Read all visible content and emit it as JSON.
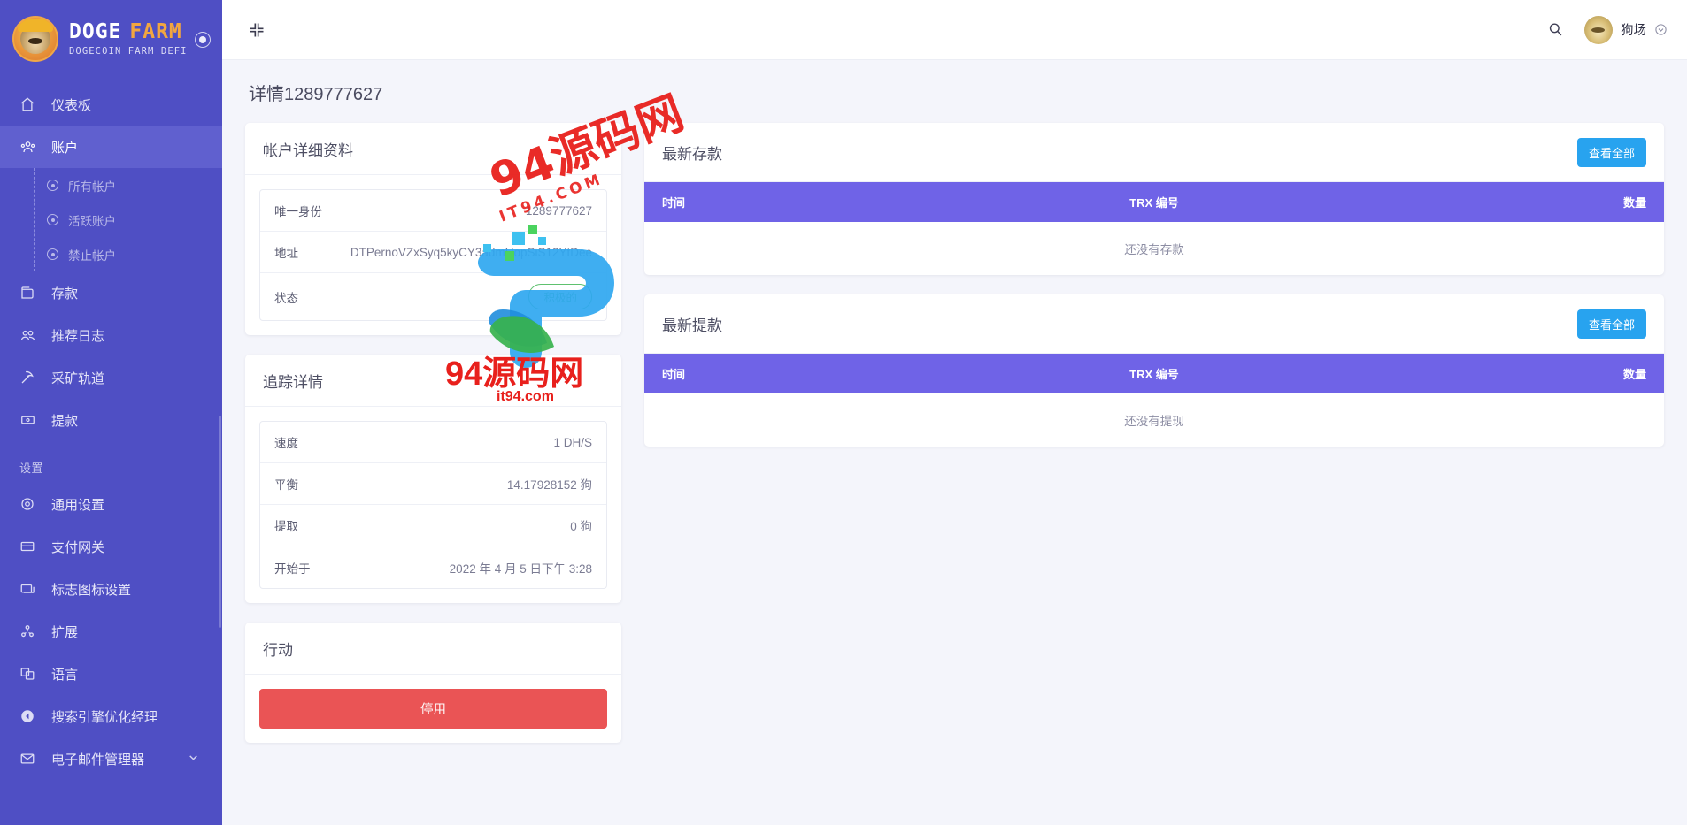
{
  "brand": {
    "title_part1": "DOGE",
    "title_part2": "FARM",
    "subtitle": "DOGECOIN FARM DEFI",
    "toggle_icon": "circle-dot-icon"
  },
  "sidebar": {
    "items": [
      {
        "label": "仪表板",
        "icon": "home-icon",
        "active": false
      },
      {
        "label": "账户",
        "icon": "users-icon",
        "active": true
      }
    ],
    "sub_items": [
      {
        "label": "所有帐户",
        "icon": "circle-dot-icon"
      },
      {
        "label": "活跃账户",
        "icon": "circle-dot-icon"
      },
      {
        "label": "禁止帐户",
        "icon": "circle-dot-icon"
      }
    ],
    "items2": [
      {
        "label": "存款",
        "icon": "wallet-icon"
      },
      {
        "label": "推荐日志",
        "icon": "people-icon"
      },
      {
        "label": "采矿轨道",
        "icon": "pickaxe-icon"
      },
      {
        "label": "提款",
        "icon": "money-icon"
      }
    ],
    "section_label": "设置",
    "items3": [
      {
        "label": "通用设置",
        "icon": "gear-icon",
        "caret": false
      },
      {
        "label": "支付网关",
        "icon": "card-icon",
        "caret": false
      },
      {
        "label": "标志图标设置",
        "icon": "image-icon",
        "caret": false
      },
      {
        "label": "扩展",
        "icon": "extension-icon",
        "caret": false
      },
      {
        "label": "语言",
        "icon": "language-icon",
        "caret": false
      },
      {
        "label": "搜索引擎优化经理",
        "icon": "seo-icon",
        "caret": false
      },
      {
        "label": "电子邮件管理器",
        "icon": "mail-icon",
        "caret": true
      }
    ]
  },
  "topbar": {
    "collapse_icon": "collapse-arrows-icon",
    "search_icon": "search-icon",
    "user_name": "狗场",
    "user_caret_icon": "chevron-down-icon",
    "avatar_icon": "doge-avatar"
  },
  "page": {
    "title": "详情1289777627"
  },
  "account_details": {
    "title": "帐户详细资料",
    "rows": [
      {
        "key": "唯一身份",
        "value": "1289777627"
      },
      {
        "key": "地址",
        "value": "DTPernoVZxSyq5kyCY3admUopSiS12YtDee"
      },
      {
        "key": "状态",
        "value": "积极的",
        "type": "badge"
      }
    ]
  },
  "tracking_details": {
    "title": "追踪详情",
    "rows": [
      {
        "key": "速度",
        "value": "1 DH/S"
      },
      {
        "key": "平衡",
        "value": "14.17928152 狗"
      },
      {
        "key": "提取",
        "value": "0 狗"
      },
      {
        "key": "开始于",
        "value": "2022 年 4 月 5 日下午 3:28"
      }
    ]
  },
  "actions": {
    "title": "行动",
    "disable_label": "停用"
  },
  "latest_deposits": {
    "title": "最新存款",
    "view_all_label": "查看全部",
    "columns": [
      "时间",
      "TRX 编号",
      "数量"
    ],
    "empty_text": "还没有存款"
  },
  "latest_withdrawals": {
    "title": "最新提款",
    "view_all_label": "查看全部",
    "columns": [
      "时间",
      "TRX 编号",
      "数量"
    ],
    "empty_text": "还没有提现"
  },
  "watermark": {
    "top_text": "94源码网",
    "top_sub": "IT94.COM",
    "bottom_text": "94源码网",
    "bottom_sub": "it94.com"
  },
  "colors": {
    "sidebar_bg": "#4f4fc4",
    "sidebar_active": "#6060cf",
    "table_header": "#6f63e7",
    "primary_button": "#28a3ef",
    "danger_button": "#ea5455",
    "badge_green": "#5ec16f",
    "page_bg": "#f4f5fb"
  }
}
